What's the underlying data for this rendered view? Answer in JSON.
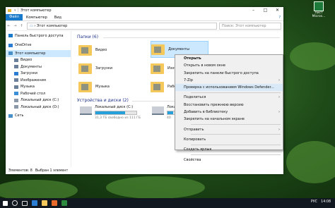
{
  "desktop": {
    "icon_label": "Лист Micros..."
  },
  "window": {
    "title": "Этот компьютер",
    "ribbon": {
      "file": "Файл",
      "tabs": [
        "Компьютер",
        "Вид"
      ]
    },
    "address": "Этот компьютер",
    "search_placeholder": "Поиск: Этот компьютер"
  },
  "sidebar": {
    "items": [
      {
        "label": "Панель быстрого доступа",
        "icon": "star-icon",
        "color": "#1979ca"
      },
      {
        "label": "OneDrive",
        "icon": "cloud-icon",
        "color": "#2b7cd3"
      },
      {
        "label": "Этот компьютер",
        "icon": "computer-icon",
        "color": "#4a90c8",
        "selected": true
      },
      {
        "label": "Видео",
        "icon": "video-folder-icon",
        "color": "#6a7f9a"
      },
      {
        "label": "Документы",
        "icon": "documents-folder-icon",
        "color": "#6a7f9a"
      },
      {
        "label": "Загрузки",
        "icon": "downloads-folder-icon",
        "color": "#2b7cd3"
      },
      {
        "label": "Изображения",
        "icon": "pictures-folder-icon",
        "color": "#6a7f9a"
      },
      {
        "label": "Музыка",
        "icon": "music-folder-icon",
        "color": "#6a7f9a"
      },
      {
        "label": "Рабочий стол",
        "icon": "desktop-folder-icon",
        "color": "#3a8fd8"
      },
      {
        "label": "Локальный диск (C:)",
        "icon": "drive-icon",
        "color": "#8a98a8"
      },
      {
        "label": "Локальный диск (D:)",
        "icon": "drive-icon",
        "color": "#8a98a8"
      },
      {
        "label": "Сеть",
        "icon": "network-icon",
        "color": "#4a90c8"
      }
    ]
  },
  "main": {
    "folders_header": "Папки (6)",
    "folders": [
      {
        "label": "Видео",
        "selected": false
      },
      {
        "label": "Документы",
        "selected": true
      },
      {
        "label": "Загрузки",
        "selected": false
      },
      {
        "label": "Изобра",
        "selected": false
      },
      {
        "label": "Музыка",
        "selected": false
      },
      {
        "label": "Рабоч",
        "selected": false
      }
    ],
    "drives_header": "Устройства и диски (2)",
    "drives": [
      {
        "name": "Локальный диск (C:)",
        "free": "31,3 ГБ свободно из 111 ГБ",
        "used_fraction": 0.72
      },
      {
        "name": "Локаль",
        "free": "40",
        "used_fraction": 0.35
      }
    ]
  },
  "status": {
    "items": "Элементов: 8",
    "selected": "Выбран 1 элемент"
  },
  "context_menu": {
    "items": [
      {
        "label": "Открыть",
        "bold": true
      },
      {
        "label": "Открыть в новом окне"
      },
      {
        "label": "Закрепить на панели быстрого доступа"
      },
      {
        "label": "7-Zip",
        "submenu": true
      },
      {
        "label": "Проверка с использованием Windows Defender...",
        "highlighted": true
      },
      {
        "sep": true
      },
      {
        "label": "Поделиться",
        "submenu": true
      },
      {
        "label": "Восстановить прежнюю версию"
      },
      {
        "label": "Добавить в библиотеку",
        "submenu": true
      },
      {
        "label": "Закрепить на начальном экране"
      },
      {
        "sep": true
      },
      {
        "label": "Отправить",
        "submenu": true
      },
      {
        "sep": true
      },
      {
        "label": "Копировать"
      },
      {
        "sep": true
      },
      {
        "label": "Создать ярлык"
      },
      {
        "sep": true
      },
      {
        "label": "Свойства"
      }
    ]
  },
  "taskbar": {
    "lang": "РУС",
    "time": "14:08"
  }
}
